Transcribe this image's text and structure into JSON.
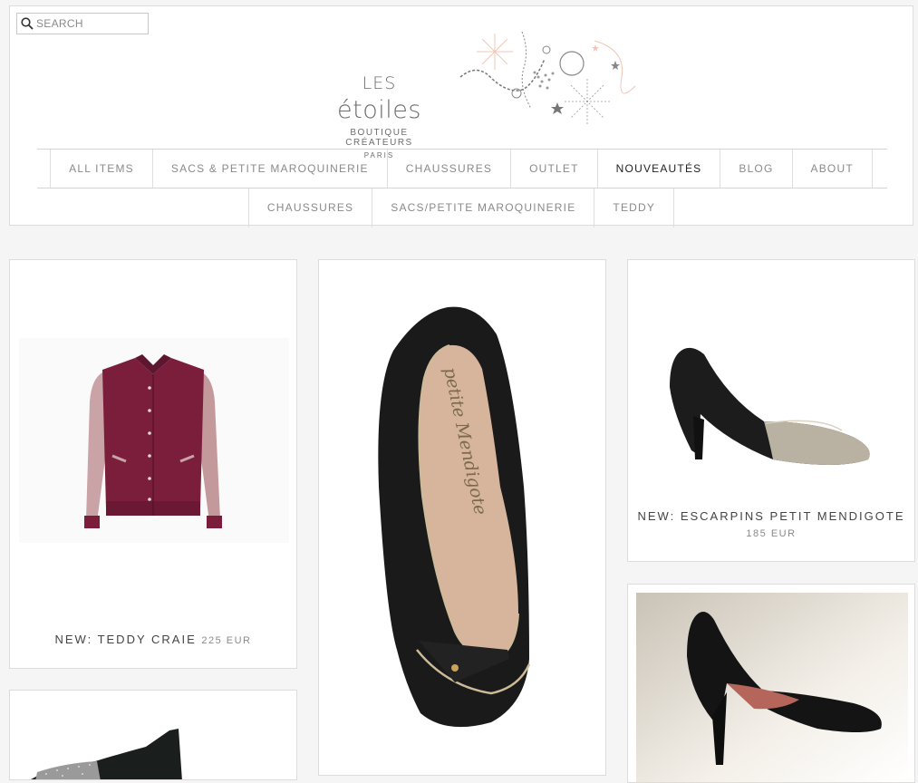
{
  "search": {
    "placeholder": "SEARCH"
  },
  "logo": {
    "prefix": "LES",
    "name": "étoiles",
    "tagline": "BOUTIQUE CRÉATEURS",
    "city": "PARIS"
  },
  "nav": {
    "primary": [
      {
        "label": "ALL ITEMS"
      },
      {
        "label": "SACS & PETITE MAROQUINERIE"
      },
      {
        "label": "CHAUSSURES"
      },
      {
        "label": "OUTLET"
      },
      {
        "label": "NOUVEAUTÉS",
        "active": true
      },
      {
        "label": "BLOG"
      },
      {
        "label": "ABOUT"
      }
    ],
    "secondary": [
      {
        "label": "CHAUSSURES"
      },
      {
        "label": "SACS/PETITE MAROQUINERIE"
      },
      {
        "label": "TEDDY"
      }
    ]
  },
  "products": [
    {
      "name": "NEW: TEDDY CRAIE",
      "price": "225 EUR",
      "image_icon": "jacket-image"
    },
    {
      "name": "",
      "price": "",
      "image_icon": "peep-toe-pump-image",
      "shoe_lettering": "petite Mendigote"
    },
    {
      "name": "NEW: ESCARPINS PETIT MENDIGOTE",
      "price": "185 EUR",
      "image_icon": "pump-image"
    },
    {
      "name": "",
      "price": "",
      "image_icon": "black-pump-photo"
    },
    {
      "name": "",
      "price": "",
      "image_icon": "ankle-boot-image"
    }
  ],
  "colors": {
    "jacket": "#7a1e3c",
    "sleeve": "#c9a3a6",
    "shoe": "#1a1a1a",
    "lining": "#d7b59c",
    "background": "#f5f5f5"
  }
}
